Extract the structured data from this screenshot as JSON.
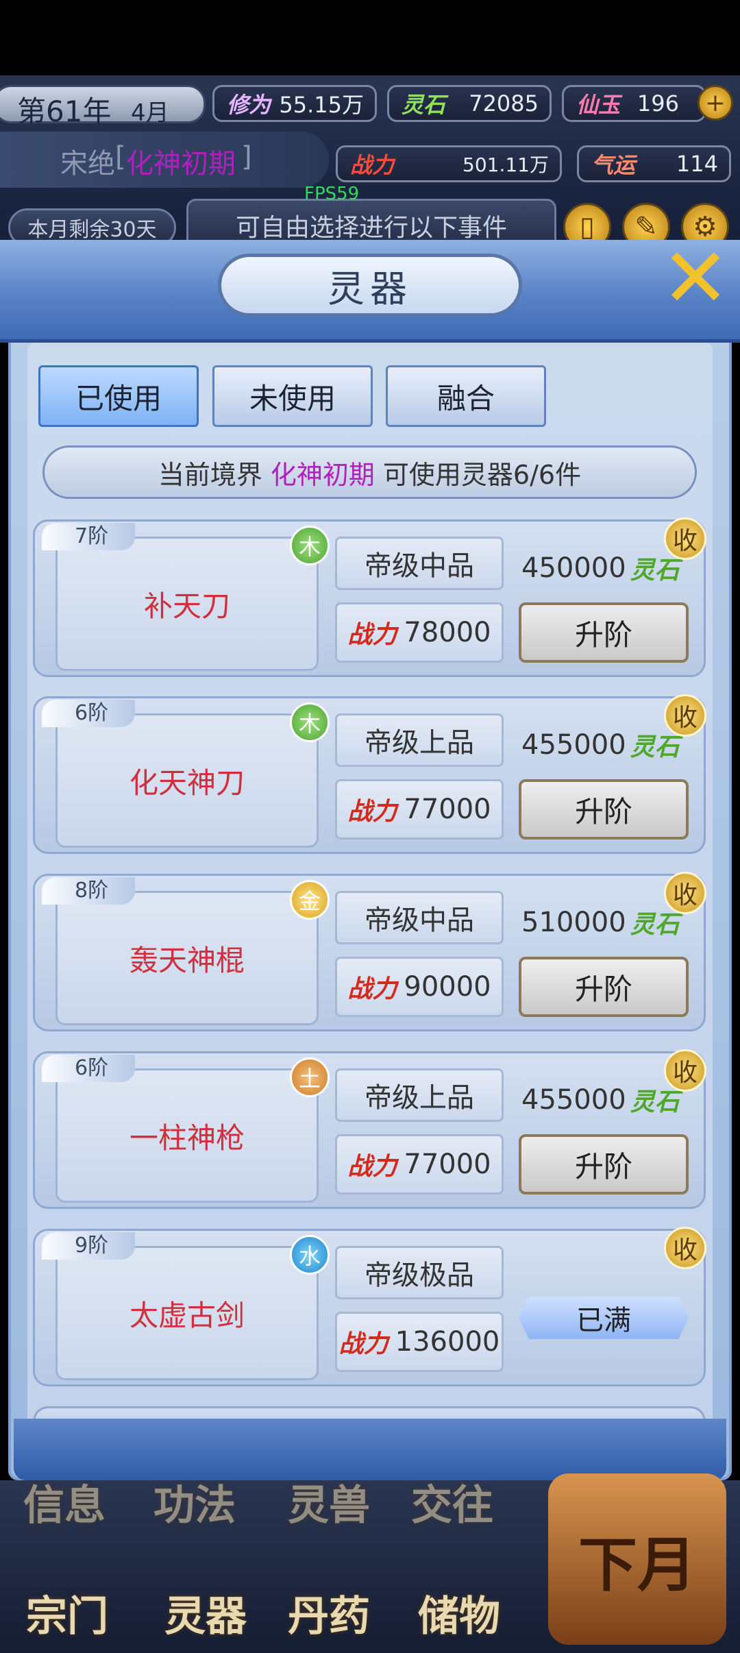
{
  "hud": {
    "year": "第61年",
    "month": "4月",
    "cultivation": {
      "label": "修为",
      "value": "55.15万"
    },
    "spirit_stone": {
      "label": "灵石",
      "value": "72085"
    },
    "jade": {
      "label": "仙玉",
      "value": "196"
    },
    "name": "宋绝",
    "realm": "化神初期",
    "power": {
      "label": "战力",
      "value": "501.11万"
    },
    "luck": {
      "label": "气运",
      "value": "114"
    },
    "days_left": "本月剩余30天",
    "event_text": "可自由选择进行以下事件",
    "fps": "FPS59"
  },
  "panel": {
    "title": "灵器",
    "tabs": [
      "已使用",
      "未使用",
      "融合"
    ],
    "realm_prefix": "当前境界",
    "realm_value": "化神初期",
    "realm_suffix": "可使用灵器6/6件",
    "power_label": "战力",
    "stone_label": "灵石",
    "upgrade_label": "升阶",
    "collect_label": "收",
    "full_label": "已满"
  },
  "items": [
    {
      "tier": "7阶",
      "name": "补天刀",
      "element": "木",
      "quality": "帝级中品",
      "power": "78000",
      "cost": "450000"
    },
    {
      "tier": "6阶",
      "name": "化天神刀",
      "element": "木",
      "quality": "帝级上品",
      "power": "77000",
      "cost": "455000"
    },
    {
      "tier": "8阶",
      "name": "轰天神棍",
      "element": "金",
      "quality": "帝级中品",
      "power": "90000",
      "cost": "510000"
    },
    {
      "tier": "6阶",
      "name": "一柱神枪",
      "element": "土",
      "quality": "帝级上品",
      "power": "77000",
      "cost": "455000"
    },
    {
      "tier": "9阶",
      "name": "太虚古剑",
      "element": "水",
      "quality": "帝级极品",
      "power": "136000"
    }
  ],
  "menu": {
    "row1": [
      "信息",
      "功法",
      "灵兽",
      "交往"
    ],
    "row2": [
      "宗门",
      "灵器",
      "丹药",
      "储物"
    ],
    "next_month": "下月"
  }
}
